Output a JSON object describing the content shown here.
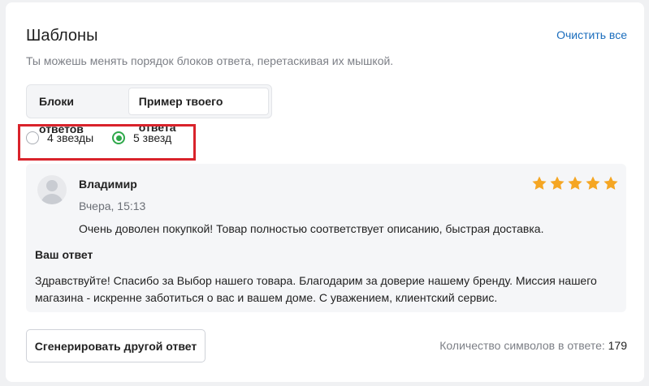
{
  "templates": {
    "title": "Шаблоны",
    "clear_all": "Очистить все",
    "subtitle": "Ты можешь менять порядок блоков ответа, перетаскивая их мышкой."
  },
  "tabs": [
    {
      "label": "Блоки ответов",
      "active": false
    },
    {
      "label": "Пример твоего ответа",
      "active": true
    }
  ],
  "rating_options": [
    {
      "label": "4 звезды",
      "checked": false
    },
    {
      "label": "5 звезд",
      "checked": true
    }
  ],
  "review": {
    "author": "Владимир",
    "date": "Вчера, 15:13",
    "stars": 5,
    "text": "Очень доволен покупкой! Товар полностью соответствует описанию, быстрая доставка.",
    "answer_title": "Ваш ответ",
    "answer_text": "Здравствуйте! Спасибо за Выбор нашего товара. Благодарим за доверие нашему бренду. Миссия нашего магазина - искренне заботиться о вас и вашем доме. С уважением, клиентский сервис."
  },
  "footer": {
    "generate_button": "Сгенерировать другой ответ",
    "char_count_label": "Количество символов в ответе:",
    "char_count_value": "179"
  },
  "colors": {
    "accent_link": "#1a6dbd",
    "radio_checked": "#2ea84a",
    "highlight_border": "#d9232b",
    "star": "#f5a623"
  }
}
